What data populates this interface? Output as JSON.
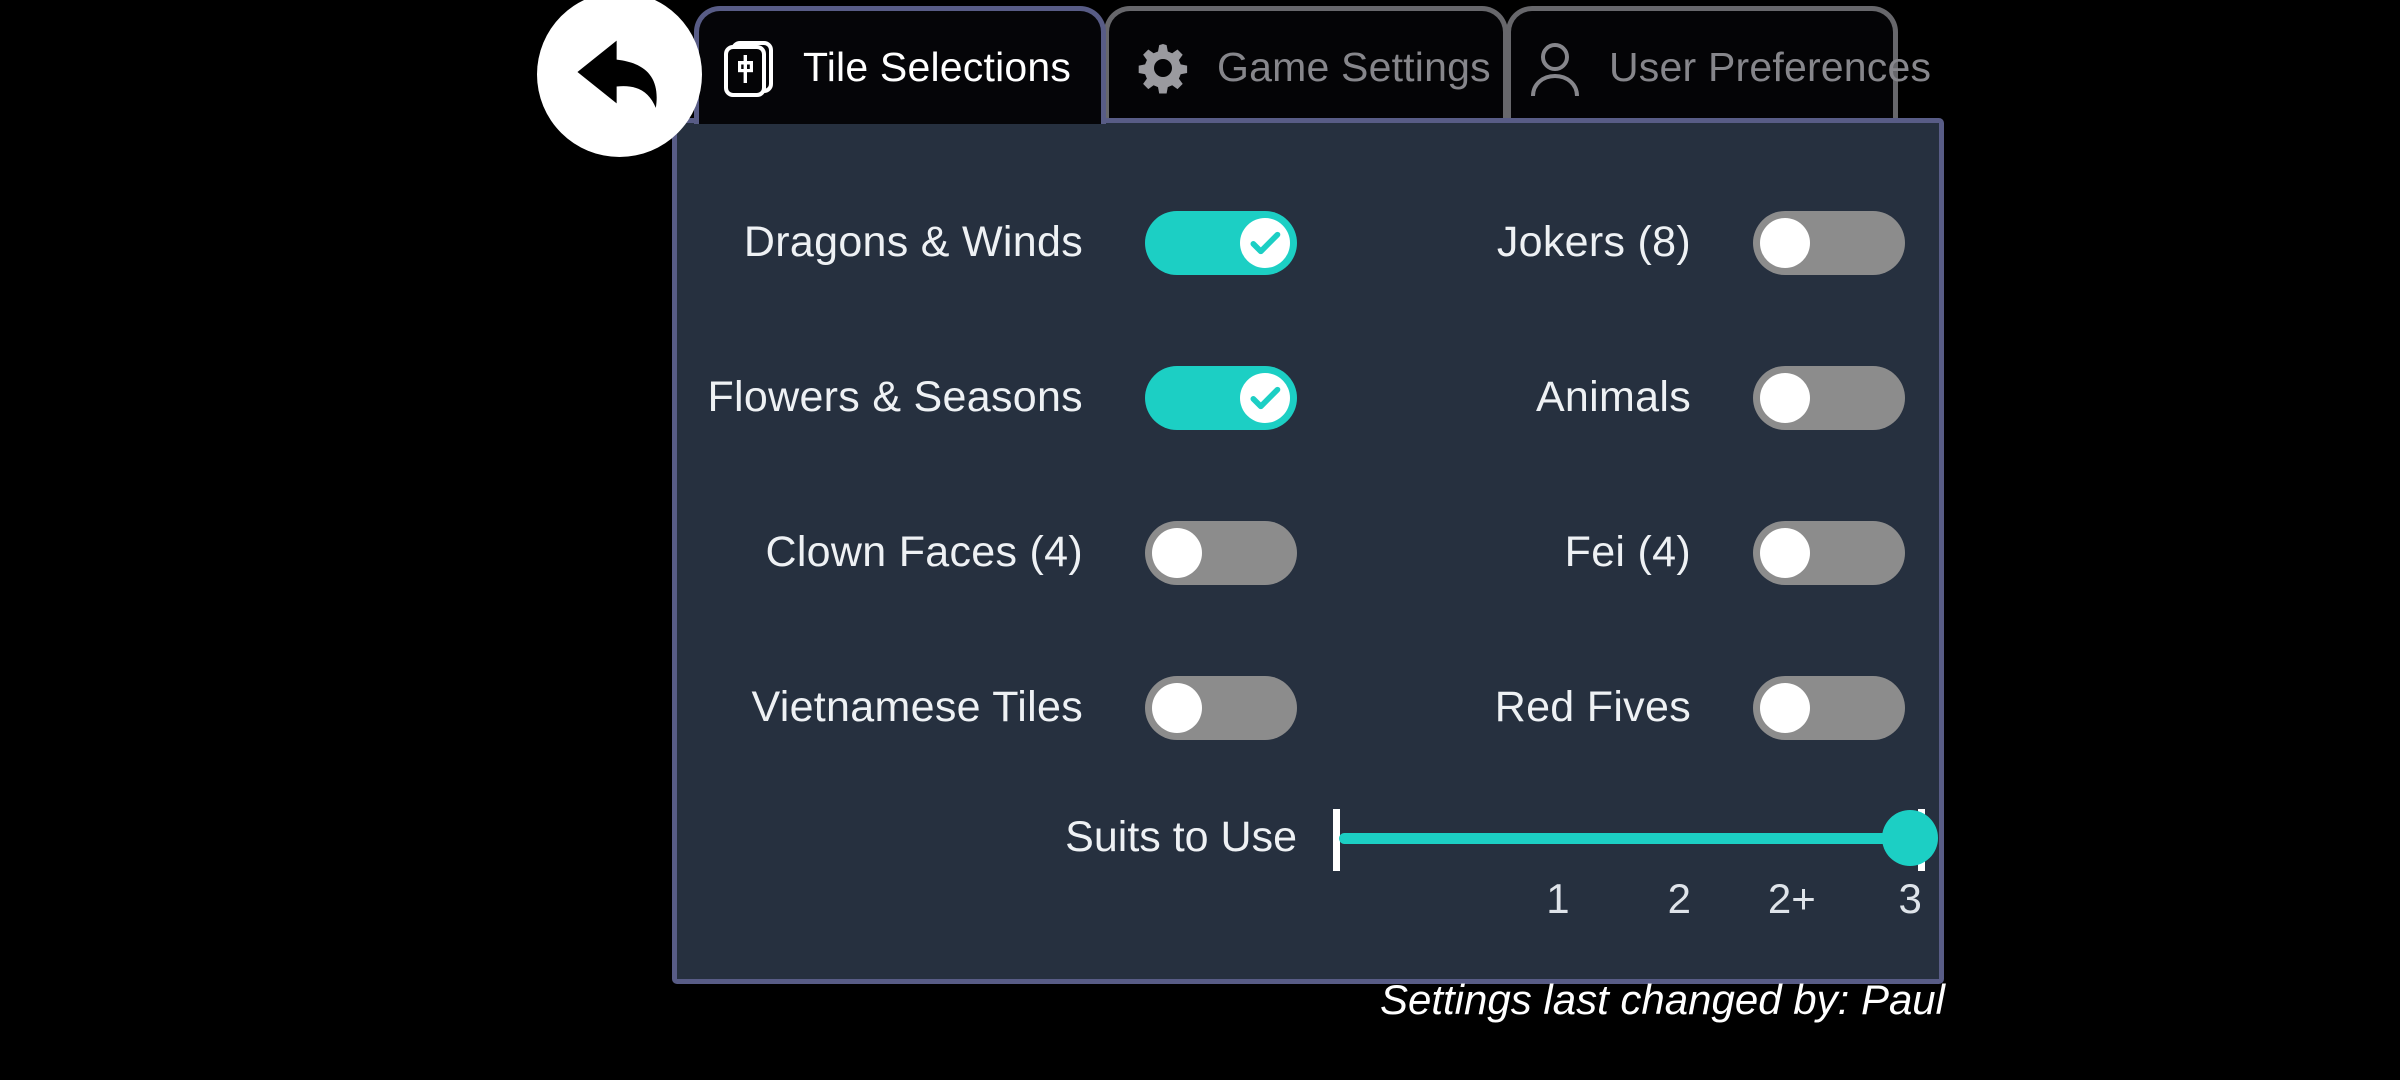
{
  "back_button": {
    "icon": "back-arrow-icon"
  },
  "tabs": [
    {
      "id": "tile",
      "label": "Tile Selections",
      "icon": "mahjong-tile-icon",
      "active": true
    },
    {
      "id": "game",
      "label": "Game Settings",
      "icon": "gear-icon",
      "active": false
    },
    {
      "id": "user",
      "label": "User Preferences",
      "icon": "user-icon",
      "active": false
    }
  ],
  "options": {
    "left": [
      {
        "label": "Dragons & Winds",
        "state": "on"
      },
      {
        "label": "Flowers & Seasons",
        "state": "on"
      },
      {
        "label": "Clown Faces (4)",
        "state": "off"
      },
      {
        "label": "Vietnamese Tiles",
        "state": "off"
      }
    ],
    "right": [
      {
        "label": "Jokers (8)",
        "state": "off"
      },
      {
        "label": "Animals",
        "state": "off"
      },
      {
        "label": "Fei (4)",
        "state": "off"
      },
      {
        "label": "Red Fives",
        "state": "off"
      }
    ]
  },
  "slider": {
    "label": "Suits to Use",
    "ticks": [
      "1",
      "2",
      "2+",
      "3"
    ],
    "selected": "3",
    "selected_index": 3,
    "fill_percent": 100
  },
  "footer": {
    "note": "Settings last changed by: Paul"
  },
  "colors": {
    "accent_teal": "#1ccfc4",
    "toggle_off": "#8c8c8c",
    "panel_bg": "#26303f",
    "panel_border": "#585c86",
    "tab_inactive_border": "#67676b",
    "tab_inactive_text": "#86868b",
    "page_bg": "#000000"
  }
}
